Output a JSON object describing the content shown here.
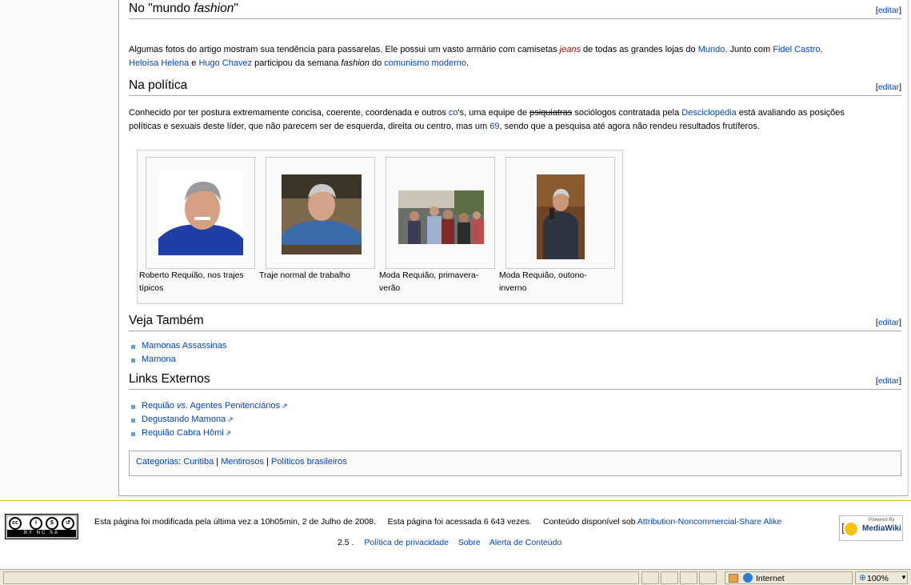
{
  "sections": {
    "fashion": {
      "title_prefix": "No \"mundo ",
      "title_em": "fashion",
      "title_suffix": "\"",
      "edit": "editar"
    },
    "politica": {
      "title": "Na política",
      "edit": "editar"
    },
    "veja": {
      "title": "Veja Também",
      "edit": "editar"
    },
    "links": {
      "title": "Links Externos",
      "edit": "editar"
    }
  },
  "fashion_para": {
    "t1": "Algumas fotos do artigo mostram sua tendência para passarelas. Ele possui um vasto armário com camisetas ",
    "jeans": "jeans",
    "t2": " de todas as grandes lojas do ",
    "mundo": "Mundo",
    "t3": ". Junto com ",
    "fidel": "Fidel Castro,",
    "heloisa": "Heloísa Helena",
    "t4": " e ",
    "hugo": "Hugo Chavez",
    "t5": " participou da semana ",
    "fashion": "fashion",
    "t6": " do ",
    "comunismo": "comunismo moderno",
    "t7": "."
  },
  "politica_para": {
    "t1": "Conhecido por ter postura extremamente concisa, coerente, coordenada e outros ",
    "cos": "co",
    "t2": "'s, uma equipe de ",
    "strike": "psiquiatras",
    "t3": " sociólogos contratada pela ",
    "descic": "Desciclopédia",
    "t4": " está avaliando as posições",
    "line2a": "políticas e sexuais deste líder, que não parecem ser de esquerda, direita ou centro, mas um ",
    "n69": "69",
    "line2b": ", sendo que a pesquisa até agora não rendeu resultados frutíferos."
  },
  "gallery": [
    {
      "caption": "Roberto Requião, nos trajes típicos"
    },
    {
      "caption": "Traje normal de trabalho"
    },
    {
      "caption": "Moda Requião, primavera-verão"
    },
    {
      "caption": "Moda Requião, outono-inverno"
    }
  ],
  "veja_items": [
    "Mamonas Assassinas",
    "Mamona"
  ],
  "external_links": [
    {
      "pre": "Requião ",
      "em": "vs.",
      "post": " Agentes Penitenciários"
    },
    {
      "pre": "Degustando Mamona",
      "em": "",
      "post": ""
    },
    {
      "pre": "Requião Cabra Hômi",
      "em": "",
      "post": ""
    }
  ],
  "categories": {
    "label": "Categorias",
    "items": [
      "Curitiba",
      "Mentirosos",
      "Políticos brasileiros"
    ]
  },
  "footer": {
    "modified": "Esta página foi modificada pela última vez a 10h05min, 2 de Julho de 2008.",
    "accessed": "Esta página foi acessada 6 643 vezes.",
    "license_pre": "Conteúdo disponível sob ",
    "license_link": "Attribution-Noncommercial-Share Alike",
    "links_prefix": "2.5 .",
    "links": [
      "Política de privacidade",
      "Sobre",
      "Alerta de Conteúdo"
    ],
    "cc_badge": "BY  NC  SA",
    "mw_powered": "Powered By",
    "mw_name": "MediaWiki"
  },
  "statusbar": {
    "zone": "Internet",
    "zoom": "100%"
  }
}
